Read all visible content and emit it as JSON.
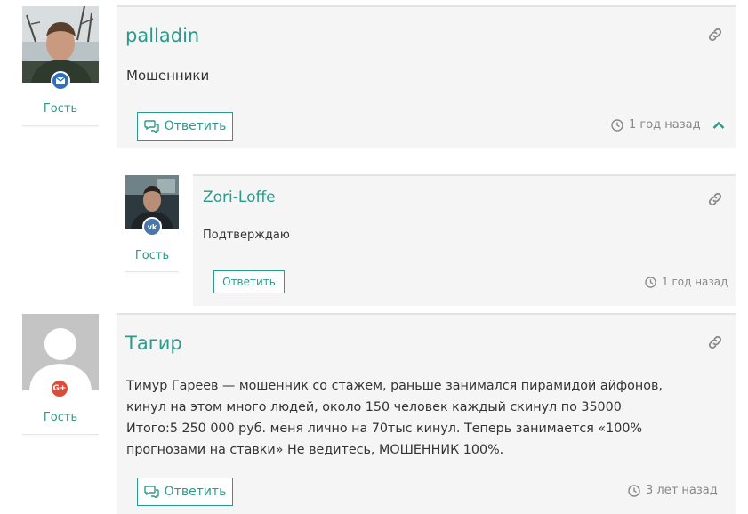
{
  "comments": [
    {
      "author": "palladin",
      "text": "Мошенники",
      "role": "Гость",
      "reply_label": "Ответить",
      "time": "1 год назад",
      "badge": {
        "icon": "envelope-icon",
        "color": "#2f6fc2"
      }
    },
    {
      "author": "Zori-Loffe",
      "text": "Подтверждаю",
      "role": "Гость",
      "reply_label": "Ответить",
      "time": "1 год назад",
      "badge": {
        "icon": "vk-icon",
        "glyph": "vk",
        "color": "#4a76a8"
      }
    },
    {
      "author": "Тагир",
      "text_lines": [
        "Тимур Гареев — мошенник со стажем, раньше занимался пирамидой айфонов,",
        "кинул на этом много людей, около 150 человек каждый скинул по 35000",
        "Итого:5 250 000 руб. меня лично на 70тыс кинул. Теперь занимается «100%",
        "прогнозами на ставки» Не ведитесь, МОШЕННИК 100%."
      ],
      "role": "Гость",
      "reply_label": "Ответить",
      "time": "3 лет назад",
      "badge": {
        "icon": "google-plus-icon",
        "glyph": "G+",
        "color": "#dd4b39"
      }
    }
  ],
  "colors": {
    "accent": "#2b9a8b",
    "card_bg": "#f5f5f5",
    "muted": "#888888"
  }
}
